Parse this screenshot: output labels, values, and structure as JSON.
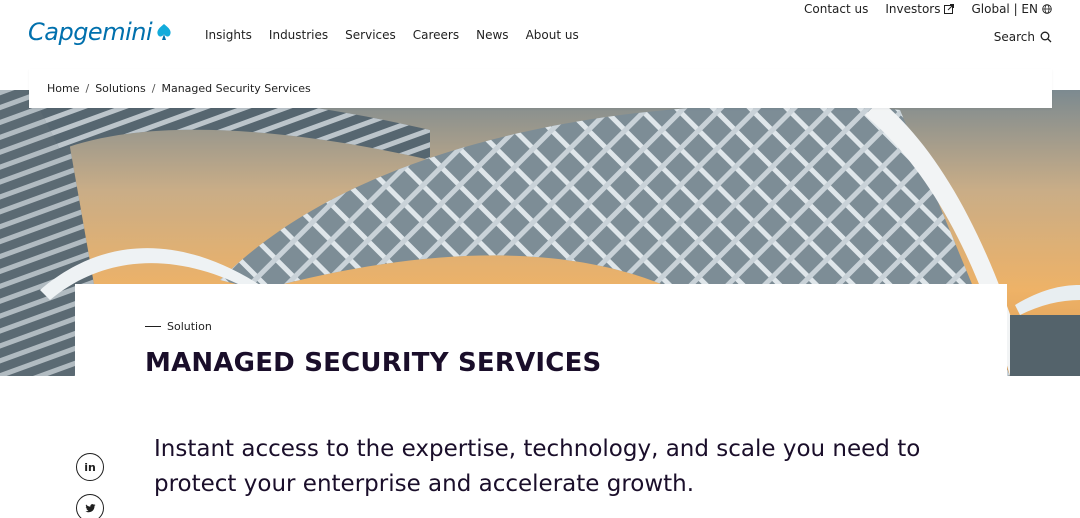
{
  "header": {
    "logo_text": "Capgemini",
    "main_nav": [
      "Insights",
      "Industries",
      "Services",
      "Careers",
      "News",
      "About us"
    ],
    "top_nav": {
      "contact": "Contact us",
      "investors": "Investors",
      "global": "Global | EN"
    },
    "search_label": "Search",
    "brand_color": "#0070ad"
  },
  "breadcrumb": {
    "items": [
      "Home",
      "Solutions",
      "Managed Security Services"
    ],
    "separator": "/"
  },
  "hero": {
    "eyebrow": "Solution",
    "title": "MANAGED SECURITY SERVICES"
  },
  "intro": {
    "text": "Instant access to the expertise, technology, and scale you need to protect your enterprise and accelerate growth."
  },
  "social": {
    "linkedin_label": "in",
    "icons": [
      "linkedin-icon",
      "twitter-icon"
    ]
  }
}
